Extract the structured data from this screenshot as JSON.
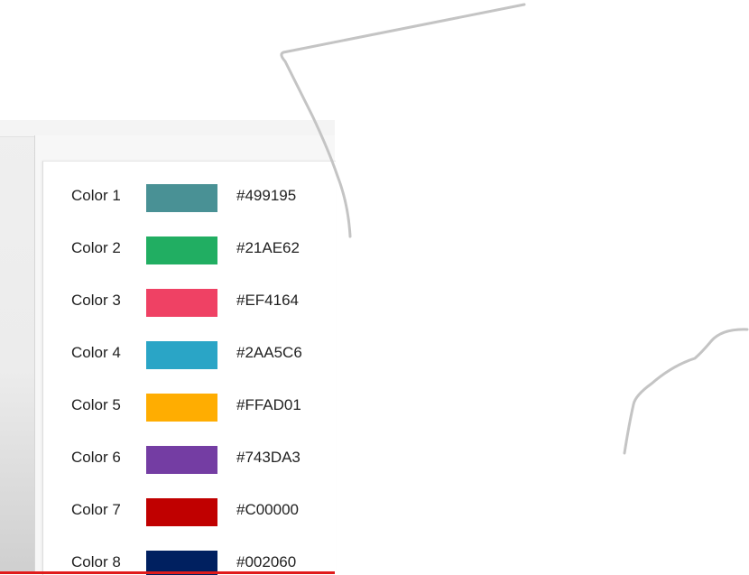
{
  "palette": {
    "rows": [
      {
        "label": "Color 1",
        "hex": "#499195",
        "color": "#499195"
      },
      {
        "label": "Color 2",
        "hex": "#21AE62",
        "color": "#21AE62"
      },
      {
        "label": "Color 3",
        "hex": "#EF4164",
        "color": "#EF4164"
      },
      {
        "label": "Color 4",
        "hex": "#2AA5C6",
        "color": "#2AA5C6"
      },
      {
        "label": "Color 5",
        "hex": "#FFAD01",
        "color": "#FFAD01"
      },
      {
        "label": "Color 6",
        "hex": "#743DA3",
        "color": "#743DA3"
      },
      {
        "label": "Color 7",
        "hex": "#C00000",
        "color": "#C00000"
      },
      {
        "label": "Color 8",
        "hex": "#002060",
        "color": "#002060"
      }
    ]
  },
  "annotation": {
    "stroke_color": "#c4c4c4"
  }
}
